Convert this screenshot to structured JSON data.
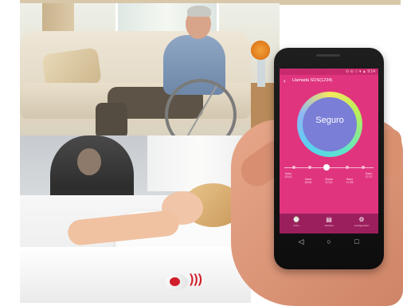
{
  "app": {
    "status_bar": "⊙ ⊙ ☆ ▾ ▲ 9:14",
    "title": "Llamada SOS(1234)",
    "status_label": "Seguro",
    "timeline": [
      {
        "label": "Hace",
        "time": "13:01"
      },
      {
        "label": "Hace",
        "time": "16:00"
      },
      {
        "label": "Ahora",
        "time": "17:01"
      },
      {
        "label": "Hace",
        "time": "17:25"
      },
      {
        "label": "Hace",
        "time": "17:27"
      }
    ],
    "slider_position_fraction": 0.47,
    "nav": [
      {
        "label": "Inicio",
        "icon": "watch-icon"
      },
      {
        "label": "Historial",
        "icon": "document-icon"
      },
      {
        "label": "Configuración",
        "icon": "gear-icon"
      }
    ]
  },
  "colors": {
    "screen_bg": "#e0357e",
    "navbar_bg": "#9c1f5d",
    "ring_center": "#7a7ed6",
    "pendant_button": "#d01f2a"
  },
  "system_nav": {
    "back": "◁",
    "home": "○",
    "recents": "□"
  },
  "pendant_signal": ")))"
}
